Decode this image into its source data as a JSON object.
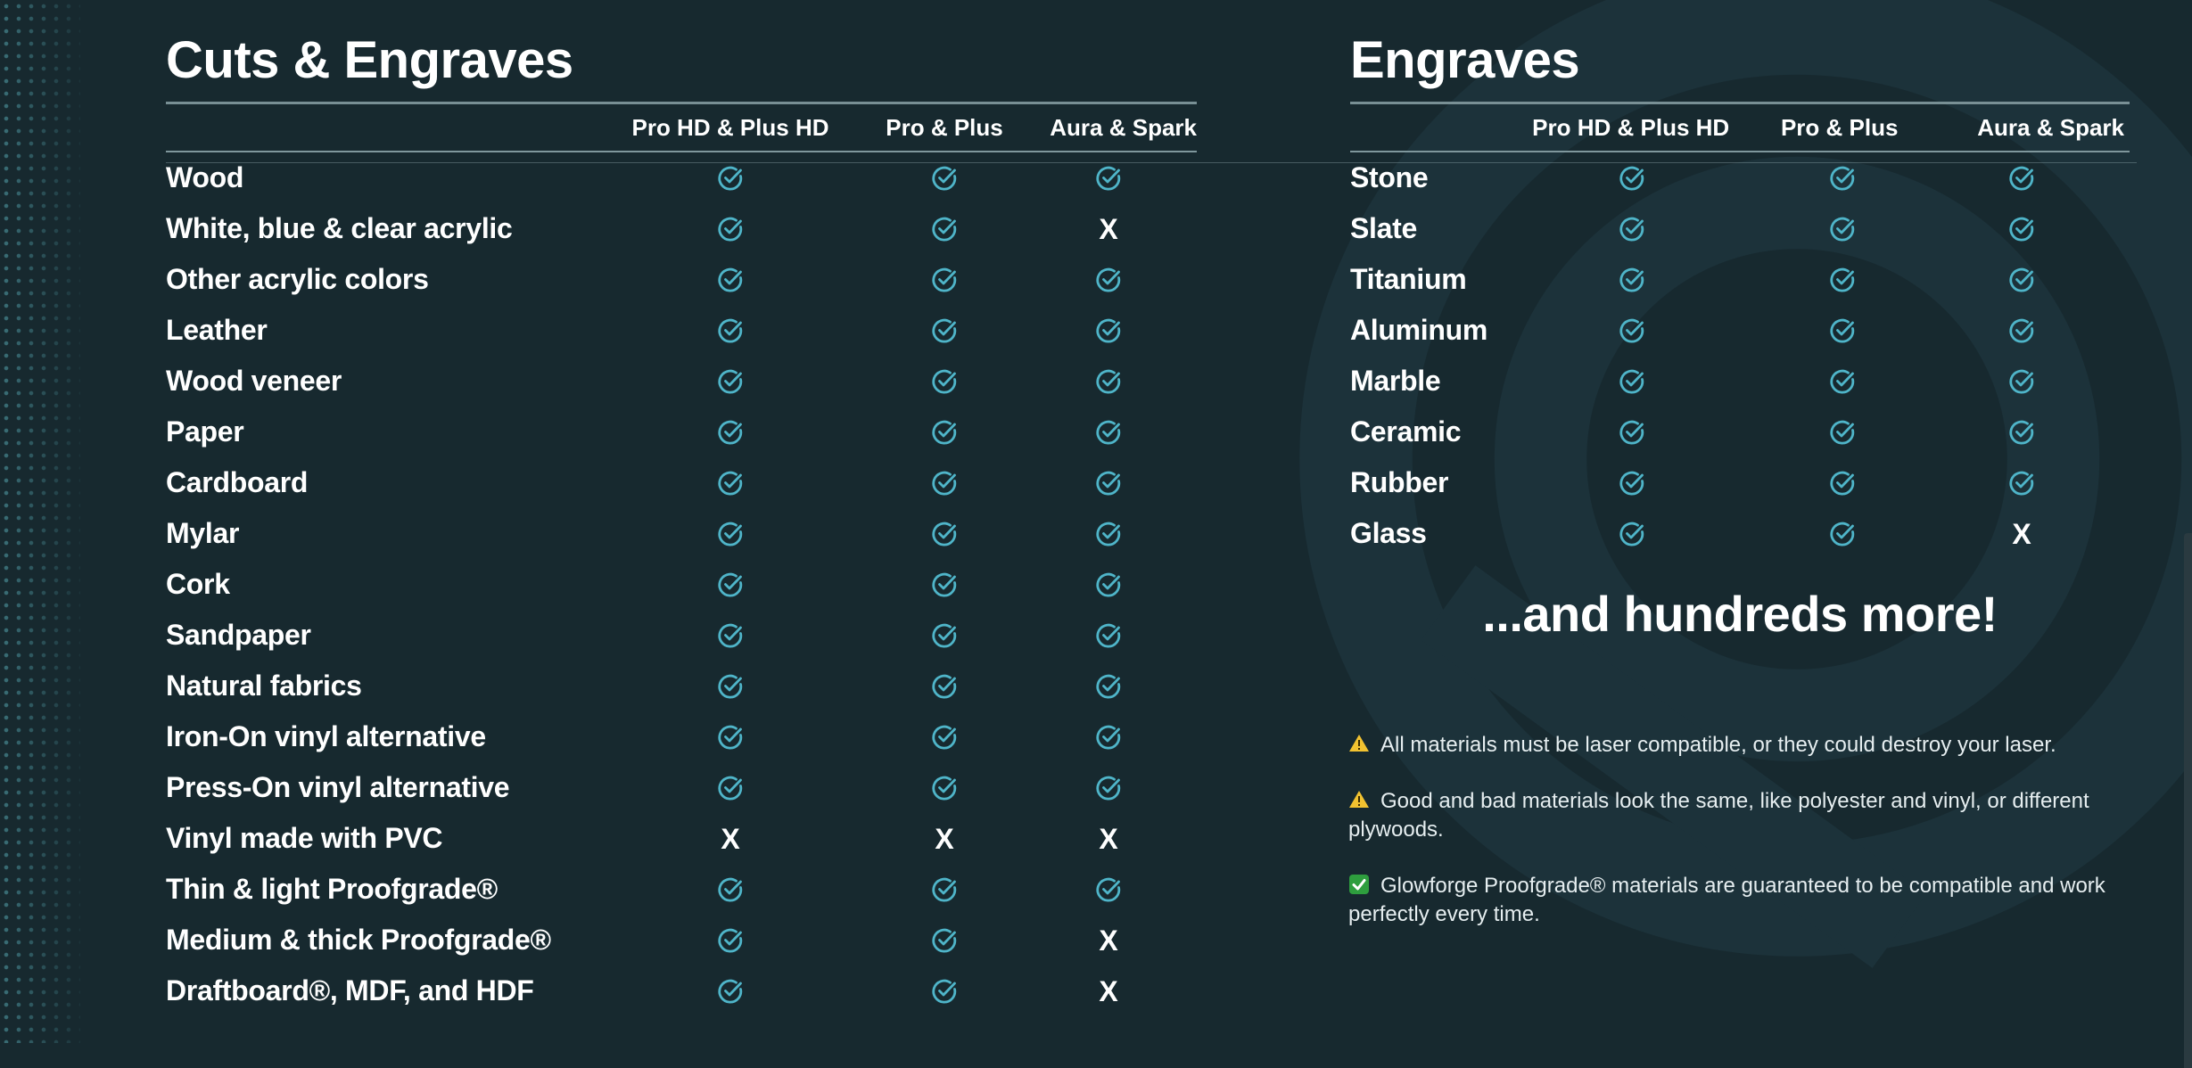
{
  "colors": {
    "background": "#17292f",
    "check": "#4fb5c9",
    "rule": "#8aa1a6",
    "warning": "#f2c230",
    "ok": "#2e9e3e"
  },
  "icons": {
    "check": "check-circle-icon",
    "x": "x-mark",
    "warning": "warning-icon",
    "ok": "check-box-icon"
  },
  "cuts_engraves": {
    "title": "Cuts & Engraves",
    "columns": [
      "Pro HD & Plus HD",
      "Pro & Plus",
      "Aura & Spark"
    ],
    "rows": [
      {
        "label": "Wood",
        "values": [
          "check",
          "check",
          "check"
        ]
      },
      {
        "label": "White, blue & clear acrylic",
        "values": [
          "check",
          "check",
          "x"
        ]
      },
      {
        "label": "Other acrylic colors",
        "values": [
          "check",
          "check",
          "check"
        ]
      },
      {
        "label": "Leather",
        "values": [
          "check",
          "check",
          "check"
        ]
      },
      {
        "label": "Wood veneer",
        "values": [
          "check",
          "check",
          "check"
        ]
      },
      {
        "label": "Paper",
        "values": [
          "check",
          "check",
          "check"
        ]
      },
      {
        "label": "Cardboard",
        "values": [
          "check",
          "check",
          "check"
        ]
      },
      {
        "label": "Mylar",
        "values": [
          "check",
          "check",
          "check"
        ]
      },
      {
        "label": "Cork",
        "values": [
          "check",
          "check",
          "check"
        ]
      },
      {
        "label": "Sandpaper",
        "values": [
          "check",
          "check",
          "check"
        ]
      },
      {
        "label": "Natural fabrics",
        "values": [
          "check",
          "check",
          "check"
        ]
      },
      {
        "label": "Iron-On vinyl alternative",
        "values": [
          "check",
          "check",
          "check"
        ]
      },
      {
        "label": "Press-On vinyl alternative",
        "values": [
          "check",
          "check",
          "check"
        ]
      },
      {
        "label": "Vinyl made with PVC",
        "values": [
          "x",
          "x",
          "x"
        ]
      },
      {
        "label": "Thin & light Proofgrade®",
        "values": [
          "check",
          "check",
          "check"
        ]
      },
      {
        "label": "Medium & thick Proofgrade®",
        "values": [
          "check",
          "check",
          "x"
        ]
      },
      {
        "label": "Draftboard®, MDF, and HDF",
        "values": [
          "check",
          "check",
          "x"
        ]
      }
    ]
  },
  "engraves": {
    "title": "Engraves",
    "columns": [
      "Pro HD & Plus HD",
      "Pro & Plus",
      "Aura & Spark"
    ],
    "rows": [
      {
        "label": "Stone",
        "values": [
          "check",
          "check",
          "check"
        ]
      },
      {
        "label": "Slate",
        "values": [
          "check",
          "check",
          "check"
        ]
      },
      {
        "label": "Titanium",
        "values": [
          "check",
          "check",
          "check"
        ]
      },
      {
        "label": "Aluminum",
        "values": [
          "check",
          "check",
          "check"
        ]
      },
      {
        "label": "Marble",
        "values": [
          "check",
          "check",
          "check"
        ]
      },
      {
        "label": "Ceramic",
        "values": [
          "check",
          "check",
          "check"
        ]
      },
      {
        "label": "Rubber",
        "values": [
          "check",
          "check",
          "check"
        ]
      },
      {
        "label": "Glass",
        "values": [
          "check",
          "check",
          "x"
        ]
      }
    ]
  },
  "more_text": "...and hundreds more!",
  "notes": [
    {
      "icon": "warning",
      "text": "All materials must be laser compatible, or they could destroy your laser."
    },
    {
      "icon": "warning",
      "text": "Good and bad materials look the same, like polyester and vinyl, or different plywoods."
    },
    {
      "icon": "ok",
      "text": "Glowforge Proofgrade® materials are guaranteed to be compatible and work perfectly every time."
    }
  ]
}
